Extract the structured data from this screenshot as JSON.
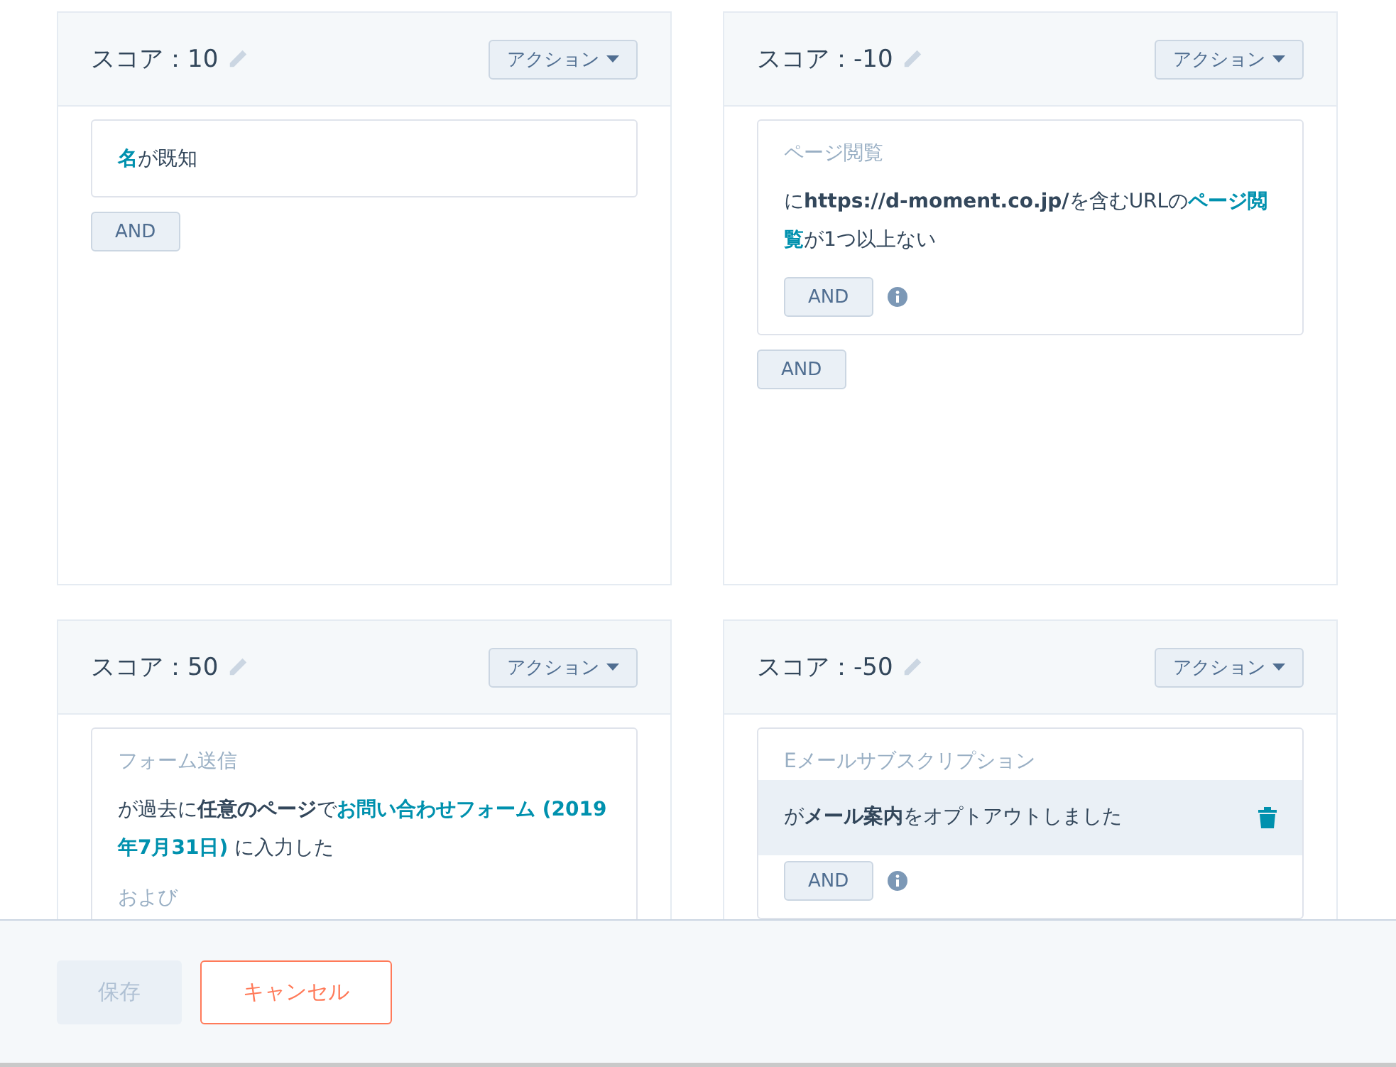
{
  "cards": [
    {
      "score": "スコア：10",
      "action": "アクション",
      "filters": [
        {
          "parts": [
            {
              "text": "名",
              "kind": "link"
            },
            {
              "text": "が既知",
              "kind": "plain"
            }
          ],
          "hovered": false
        }
      ],
      "and_button": "AND"
    },
    {
      "score": "スコア：-10",
      "action": "アクション",
      "filters": [
        {
          "category": "ページ閲覧",
          "parts": [
            {
              "text": "に",
              "kind": "plain"
            },
            {
              "text": "https://d-moment.co.jp/",
              "kind": "bold"
            },
            {
              "text": "を含むURLの",
              "kind": "plain"
            },
            {
              "text": "ページ閲覧",
              "kind": "link"
            },
            {
              "text": "が1つ以上ない",
              "kind": "plain"
            }
          ],
          "hovered": false,
          "inner_and": "AND"
        }
      ],
      "and_button": "AND"
    },
    {
      "score": "スコア：50",
      "action": "アクション",
      "filters": [
        {
          "category": "フォーム送信",
          "parts": [
            {
              "text": "が過去に",
              "kind": "plain"
            },
            {
              "text": "任意のページ",
              "kind": "bold"
            },
            {
              "text": "で",
              "kind": "plain"
            },
            {
              "text": "お問い合わせフォーム (2019年7月31日)",
              "kind": "link"
            },
            {
              "text": " に入力した",
              "kind": "plain"
            }
          ],
          "hovered": false,
          "next_label": "および"
        }
      ]
    },
    {
      "score": "スコア：-50",
      "action": "アクション",
      "filters": [
        {
          "category": "Eメールサブスクリプション",
          "parts": [
            {
              "text": "が",
              "kind": "plain"
            },
            {
              "text": "メール案内",
              "kind": "bold"
            },
            {
              "text": "をオプトアウトしました",
              "kind": "plain"
            }
          ],
          "hovered": true,
          "inner_and": "AND"
        }
      ]
    }
  ],
  "footer": {
    "save": {
      "label": "保存",
      "disabled": true
    },
    "cancel": "キャンセル"
  }
}
